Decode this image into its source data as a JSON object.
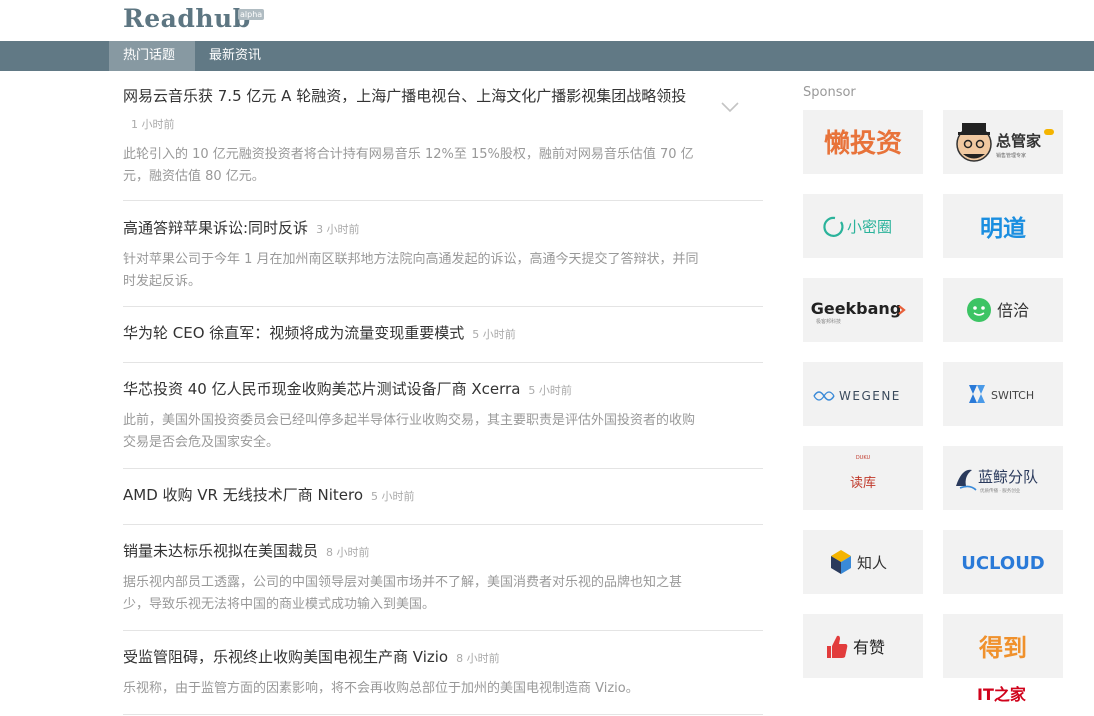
{
  "header": {
    "logo": "Readhub",
    "badge": "alpha"
  },
  "nav": {
    "tabs": [
      {
        "label": "热门话题"
      },
      {
        "label": "最新资讯"
      }
    ]
  },
  "topics": [
    {
      "title": "网易云音乐获 7.5 亿元 A 轮融资，上海广播电视台、上海文化广播影视集团战略领投",
      "time": "1 小时前",
      "summary": "此轮引入的 10 亿元融资投资者将合计持有网易音乐 12%至 15%股权，融前对网易音乐估值 70 亿元，融资估值 80 亿元。"
    },
    {
      "title": "高通答辩苹果诉讼:同时反诉",
      "time": "3 小时前",
      "summary": "针对苹果公司于今年 1 月在加州南区联邦地方法院向高通发起的诉讼，高通今天提交了答辩状，并同时发起反诉。"
    },
    {
      "title": "华为轮 CEO 徐直军：视频将成为流量变现重要模式",
      "time": "5 小时前",
      "summary": ""
    },
    {
      "title": "华芯投资 40 亿人民币现金收购美芯片测试设备厂商 Xcerra",
      "time": "5 小时前",
      "summary": "此前，美国外国投资委员会已经叫停多起半导体行业收购交易，其主要职责是评估外国投资者的收购交易是否会危及国家安全。"
    },
    {
      "title": "AMD 收购 VR 无线技术厂商 Nitero",
      "time": "5 小时前",
      "summary": ""
    },
    {
      "title": "销量未达标乐视拟在美国裁员",
      "time": "8 小时前",
      "summary": "据乐视内部员工透露，公司的中国领导层对美国市场并不了解，美国消费者对乐视的品牌也知之甚少，导致乐视无法将中国的商业模式成功输入到美国。"
    },
    {
      "title": "受监管阻碍，乐视终止收购美国电视生产商 Vizio",
      "time": "8 小时前",
      "summary": "乐视称，由于监管方面的因素影响，将不会再收购总部位于加州的美国电视制造商 Vizio。"
    }
  ],
  "sidebar": {
    "label": "Sponsor",
    "sponsors": [
      {
        "name": "懒投资",
        "color": "#e8733a"
      },
      {
        "name": "总管家",
        "sub": "销售管理专家",
        "color": "#333333"
      },
      {
        "name": "小密圈",
        "color": "#2bb39b"
      },
      {
        "name": "明道",
        "color": "#1a8ee0"
      },
      {
        "name": "Geekbang",
        "sub": "极客邦科技",
        "color": "#222222",
        "accent": "#e8603a"
      },
      {
        "name": "倍洽",
        "color": "#333333",
        "accent": "#3cc464"
      },
      {
        "name": "WEGENE",
        "color": "#3a4a5c",
        "accent": "#3a8ad8"
      },
      {
        "name": "SWITCH",
        "color": "#444444",
        "accent": "#2a7ad8"
      },
      {
        "name": "读库",
        "sub": "DUKU",
        "color": "#c0392b"
      },
      {
        "name": "蓝鲸分队",
        "sub": "优质传播 · 服务创业",
        "color": "#2a3a5c"
      },
      {
        "name": "知人",
        "color": "#333333",
        "accent": "#f4b400"
      },
      {
        "name": "UCLOUD",
        "color": "#2a7ad8"
      },
      {
        "name": "有赞",
        "color": "#222222",
        "accent": "#e23c3c"
      },
      {
        "name": "得到",
        "color": "#f0912c"
      }
    ]
  },
  "watermark": {
    "brand": "IT之家"
  }
}
